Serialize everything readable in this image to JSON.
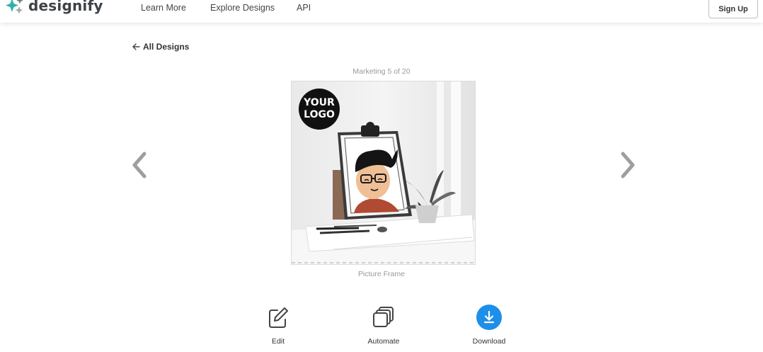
{
  "brand": {
    "name": "designify",
    "accent_colors": [
      "#2bb3a8",
      "#6c6c6c",
      "#9a9a9a"
    ]
  },
  "nav": {
    "items": [
      "Learn More",
      "Explore Designs",
      "API"
    ]
  },
  "header": {
    "signup_label": "Sign Up"
  },
  "back_link": {
    "label": "All Designs",
    "icon": "arrow-left-icon"
  },
  "gallery": {
    "counter": "Marketing 5 of 20",
    "caption": "Picture Frame",
    "logo_badge": "YOUR LOGO",
    "prev_icon": "chevron-left-icon",
    "next_icon": "chevron-right-icon"
  },
  "actions": [
    {
      "label": "Edit",
      "icon": "pencil-square-icon"
    },
    {
      "label": "Automate",
      "icon": "stack-icon"
    },
    {
      "label": "Download",
      "icon": "download-icon",
      "color": "#1e8fe8"
    }
  ]
}
